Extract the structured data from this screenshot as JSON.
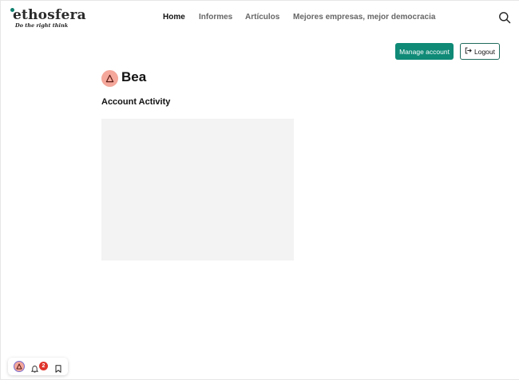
{
  "brand": {
    "name": "ethosfera",
    "tagline": "Do the right think"
  },
  "nav": {
    "items": [
      {
        "label": "Home",
        "active": true
      },
      {
        "label": "Informes",
        "active": false
      },
      {
        "label": "Artículos",
        "active": false
      },
      {
        "label": "Mejores empresas, mejor democracia",
        "active": false
      }
    ]
  },
  "account": {
    "manage_label": "Manage account",
    "logout_label": "Logout"
  },
  "profile": {
    "name": "Bea",
    "section_title": "Account Activity"
  },
  "toolbar": {
    "notification_count": "2"
  },
  "icons": {
    "search": "search-icon",
    "logout": "logout-icon",
    "avatar": "avatar-triangle-icon",
    "bell": "bell-icon",
    "bookmark": "bookmark-icon"
  },
  "colors": {
    "accent": "#0f8a77",
    "avatar_bg": "#f4a79a",
    "badge": "#e0342c",
    "panel": "#f3f3f3"
  }
}
